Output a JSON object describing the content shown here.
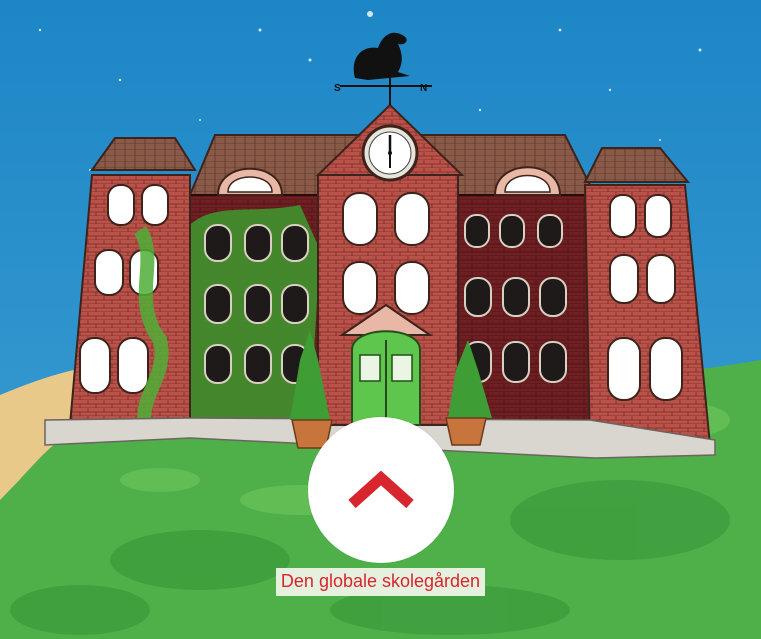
{
  "scene": {
    "weathervane_letters": {
      "south": "S",
      "north": "N"
    },
    "clock": {
      "hour": 12,
      "minute": 30
    }
  },
  "navigation": {
    "up_button_icon": "chevron-up-icon",
    "accent_color": "#d8262e"
  },
  "caption": {
    "text": "Den globale skolegården"
  }
}
